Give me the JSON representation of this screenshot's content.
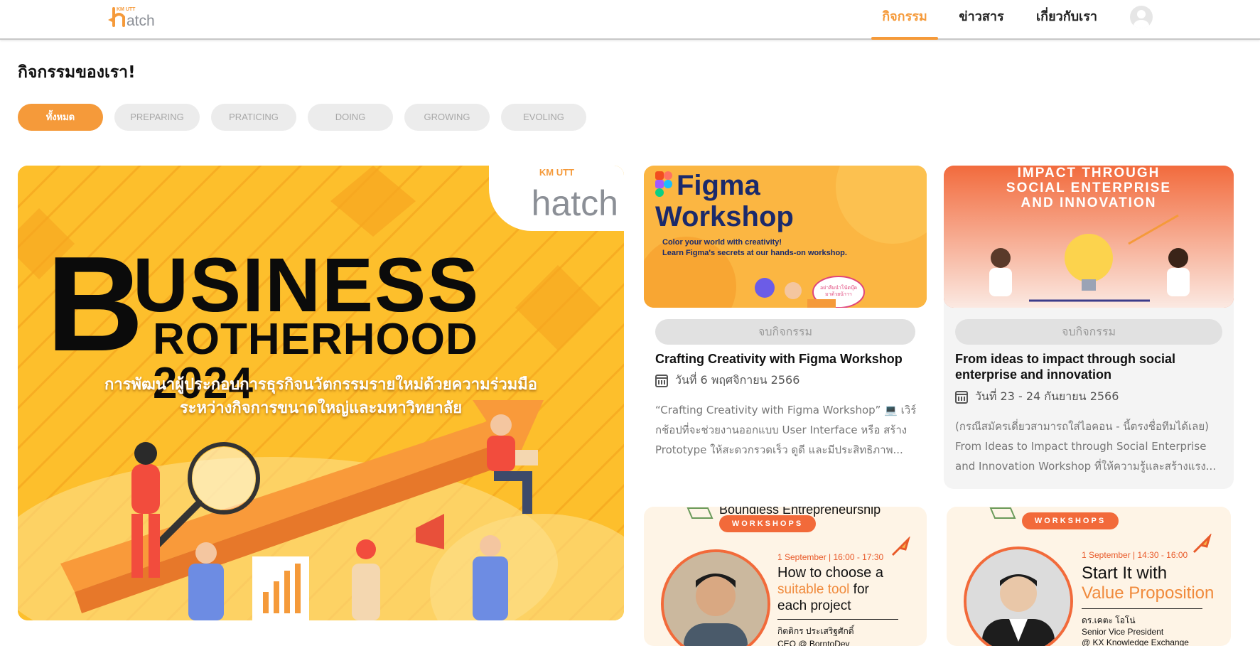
{
  "header": {
    "logo_km": "KM UTT",
    "logo_text": "hatch",
    "nav": [
      {
        "label": "กิจกรรม",
        "active": true
      },
      {
        "label": "ข่าวสาร",
        "active": false
      },
      {
        "label": "เกี่ยวกับเรา",
        "active": false
      }
    ],
    "avatar_icon": "user-avatar-icon"
  },
  "page_title": "กิจกรรมของเรา!",
  "filters": [
    {
      "label": "ทั้งหมด",
      "active": true
    },
    {
      "label": "PREPARING",
      "active": false
    },
    {
      "label": "PRATICING",
      "active": false
    },
    {
      "label": "DOING",
      "active": false
    },
    {
      "label": "GROWING",
      "active": false
    },
    {
      "label": "EVOLING",
      "active": false
    }
  ],
  "hero": {
    "title_b": "B",
    "title_usiness": "USINESS",
    "title_rother": "ROTHERHOOD 2024",
    "subtitle_line1": "การพัฒนาผู้ประกอบการธุรกิจนวัตกรรมรายใหม่ด้วยความร่วมมือ",
    "subtitle_line2": "ระหว่างกิจการขนาดใหญ่และมหาวิทยาลัย",
    "logo_km": "KM UTT",
    "logo_text": "hatch"
  },
  "cards": [
    {
      "thumb_title1": "Figma",
      "thumb_title2": "Workshop",
      "thumb_line1": "Color your world with creativity!",
      "thumb_line2": "Learn Figma's secrets at our hands-on workshop.",
      "thumb_bubble": "อย่าลืมนำโน้ตบุ๊คมาด้วยน้าาา",
      "status": "จบกิจกรรม",
      "title": "Crafting Creativity with Figma Workshop",
      "date": "วันที่ 6 พฤศจิกายน 2566",
      "desc": "“Crafting Creativity with Figma Workshop” 💻 เวิร์กช้อปที่จะช่วยงานออกแบบ User Interface หรือ สร้าง Prototype ให้สะดวกรวดเร็ว ดูดี และมีประสิทธิภาพ..."
    },
    {
      "thumb_line1": "IMPACT THROUGH",
      "thumb_line2": "SOCIAL ENTERPRISE",
      "thumb_line3": "AND INNOVATION",
      "status": "จบกิจกรรม",
      "title": "From ideas to impact through social enterprise and innovation",
      "date": "วันที่ 23 - 24 กันยายน 2566",
      "desc": "(กรณีสมัครเดี่ยวสามารถใส่ไอคอน - นี้ตรงชื่อทีมได้เลย) From Ideas to Impact through Social Enterprise and Innovation Workshop ที่ให้ความรู้และสร้างแรง..."
    }
  ],
  "workshops": [
    {
      "top": "Boundless Entrepreneurship",
      "tag": "WORKSHOPS",
      "time": "1 September | 16:00 - 17:30",
      "head1": "How to choose a",
      "head2a": "suitable tool",
      "head2b": " for",
      "head3": "each project",
      "person1": "กิตติกร ประเสริฐศักดิ์",
      "person2": "CEO @ BorntoDev"
    },
    {
      "top": "",
      "tag": "WORKSHOPS",
      "time": "1 September | 14:30 - 16:00",
      "head1": "Start It with",
      "head2a": "Value Proposition",
      "person1": "ดร.เคตะ โอโน่",
      "person2": "Senior Vice President",
      "person3": "@ KX Knowledge Exchange"
    }
  ]
}
